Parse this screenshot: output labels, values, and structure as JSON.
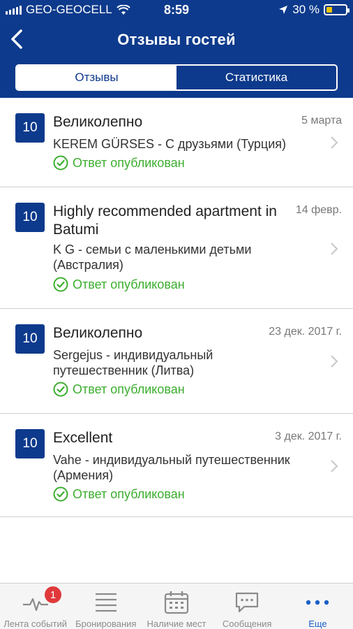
{
  "status_bar": {
    "carrier": "GEO-GEOCELL",
    "time": "8:59",
    "battery": "30 %",
    "battery_level": 0.3
  },
  "header": {
    "title": "Отзывы гостей",
    "segments": [
      "Отзывы",
      "Статистика"
    ],
    "active_segment": 0
  },
  "reviews": [
    {
      "score": "10",
      "title": "Великолепно",
      "date": "5 марта",
      "author": "KEREM GÜRSES - С друзьями (Турция)",
      "status": "Ответ опубликован"
    },
    {
      "score": "10",
      "title": "Highly recommended apartment in Batumi",
      "date": "14 февр.",
      "author": "K G - семьи с маленькими детьми (Австралия)",
      "status": "Ответ опубликован"
    },
    {
      "score": "10",
      "title": "Великолепно",
      "date": "23 дек. 2017 г.",
      "author": "Sergejus - индивидуальный путешественник (Литва)",
      "status": "Ответ опубликован"
    },
    {
      "score": "10",
      "title": "Excellent",
      "date": "3 дек. 2017 г.",
      "author": "Vahe - индивидуальный путешественник (Армения)",
      "status": "Ответ опубликован"
    }
  ],
  "tabbar": {
    "items": [
      {
        "label": "Лента событий",
        "icon": "activity-icon",
        "badge": "1"
      },
      {
        "label": "Бронирования",
        "icon": "list-icon"
      },
      {
        "label": "Наличие мест",
        "icon": "calendar-icon"
      },
      {
        "label": "Сообщения",
        "icon": "chat-icon"
      },
      {
        "label": "Еще",
        "icon": "more-icon"
      }
    ],
    "active_index": 4
  },
  "colors": {
    "brand": "#0d3a8c",
    "success": "#3cae2f",
    "badge": "#e0393b",
    "active_tab": "#1a5fc7"
  }
}
